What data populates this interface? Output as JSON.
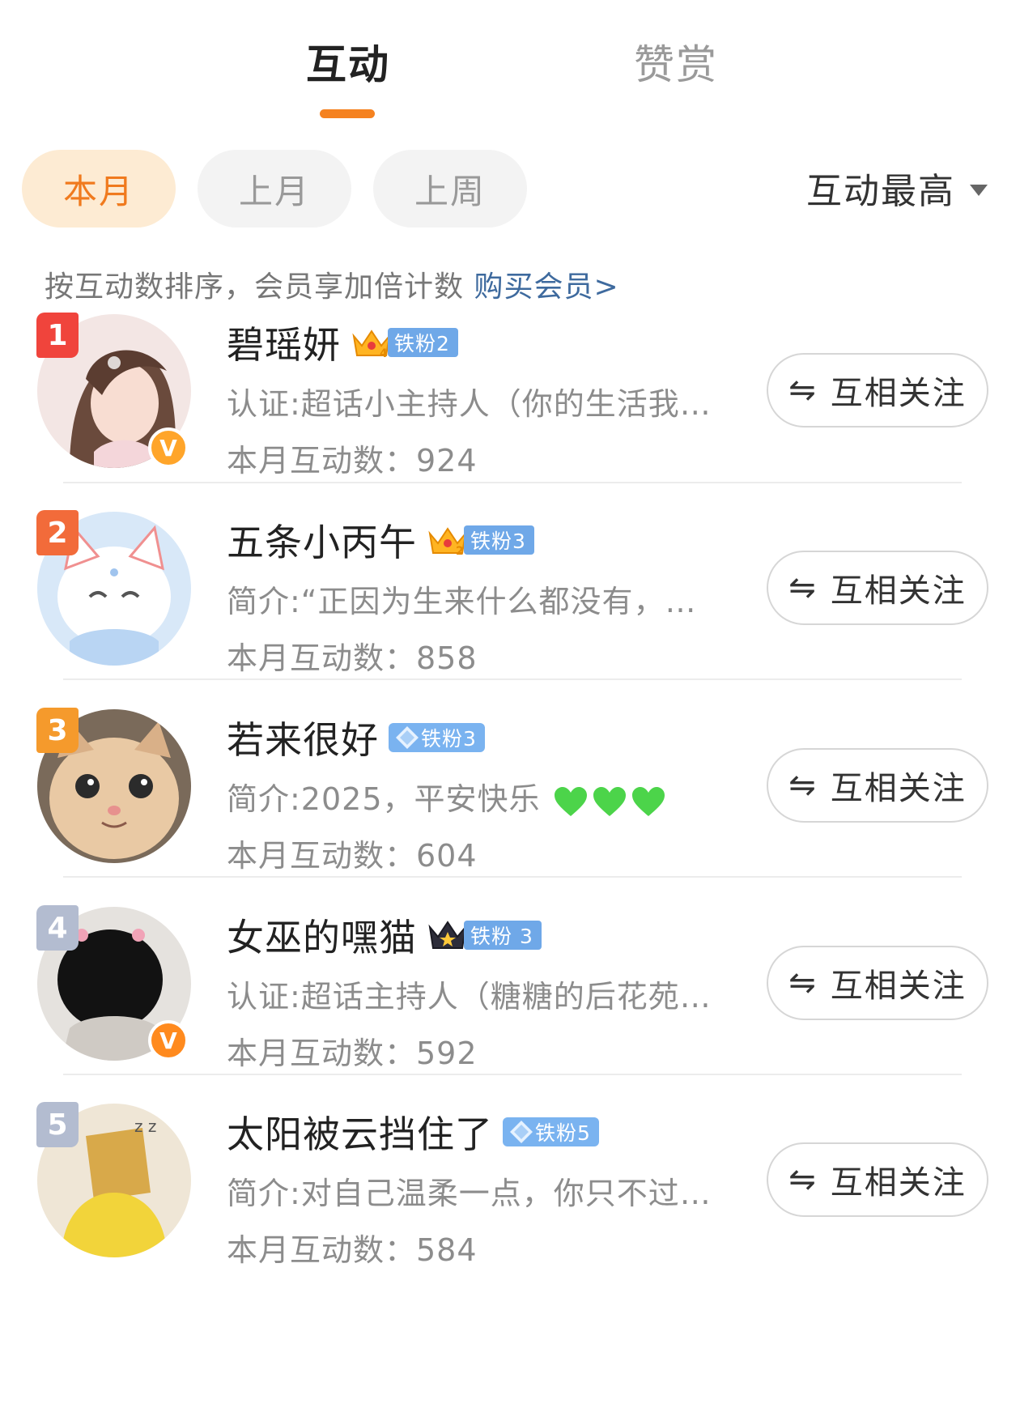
{
  "tabs": [
    {
      "label": "互动",
      "active": true
    },
    {
      "label": "赞赏",
      "active": false
    }
  ],
  "periods": [
    "本月",
    "上月",
    "上周"
  ],
  "sort": {
    "label": "互动最高"
  },
  "hint": {
    "text": "按互动数排序，会员享加倍计数 ",
    "link": "购买会员>"
  },
  "colors": {
    "accent": "#f58220",
    "rank1": "#f0443c",
    "rank2": "#f26b3a",
    "rank3": "#f59a2c",
    "rank_other": "#b3bcd0"
  },
  "follow_label": "互相关注",
  "items": [
    {
      "rank": "1",
      "name": "碧瑶妍",
      "badge_type": "crown",
      "badge_level": "4",
      "fan": "铁粉2",
      "desc": "认证:超话小主持人（你的生活我…",
      "count": "本月互动数：924",
      "verified": true
    },
    {
      "rank": "2",
      "name": "五条小丙午",
      "badge_type": "crown",
      "badge_level": "2",
      "fan": "铁粉3",
      "desc": "简介:“正因为生来什么都没有，…",
      "count": "本月互动数：858",
      "verified": false
    },
    {
      "rank": "3",
      "name": "若来很好",
      "badge_type": "diamond",
      "badge_level": "",
      "fan": "铁粉3",
      "desc": "简介:2025，平安快乐",
      "count": "本月互动数：604",
      "verified": false,
      "hearts": 3
    },
    {
      "rank": "4",
      "name": "女巫的嘿猫",
      "badge_type": "crown-dark",
      "badge_level": "",
      "fan": "铁粉 3",
      "desc": "认证:超话主持人（糖糖的后花苑…",
      "count": "本月互动数：592",
      "verified": true
    },
    {
      "rank": "5",
      "name": "太阳被云挡住了",
      "badge_type": "diamond",
      "badge_level": "",
      "fan": "铁粉5",
      "desc": "简介:对自己温柔一点，你只不过…",
      "count": "本月互动数：584",
      "verified": false
    }
  ]
}
